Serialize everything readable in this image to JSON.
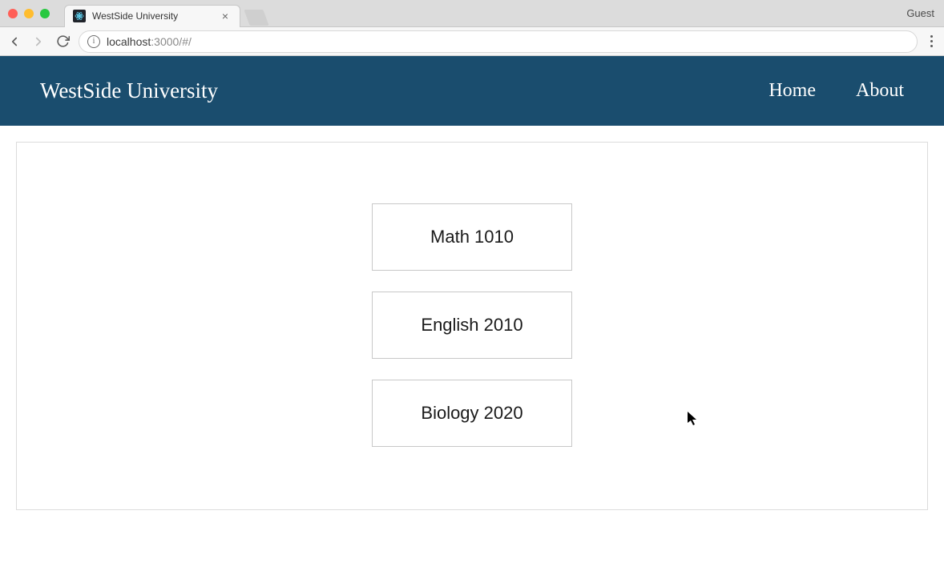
{
  "browser": {
    "tab_title": "WestSide University",
    "guest_label": "Guest",
    "url_host": "localhost",
    "url_port_path": ":3000/#/"
  },
  "header": {
    "brand": "WestSide University",
    "nav": {
      "home": "Home",
      "about": "About"
    }
  },
  "courses": [
    {
      "name": "Math 1010"
    },
    {
      "name": "English 2010"
    },
    {
      "name": "Biology 2020"
    }
  ]
}
